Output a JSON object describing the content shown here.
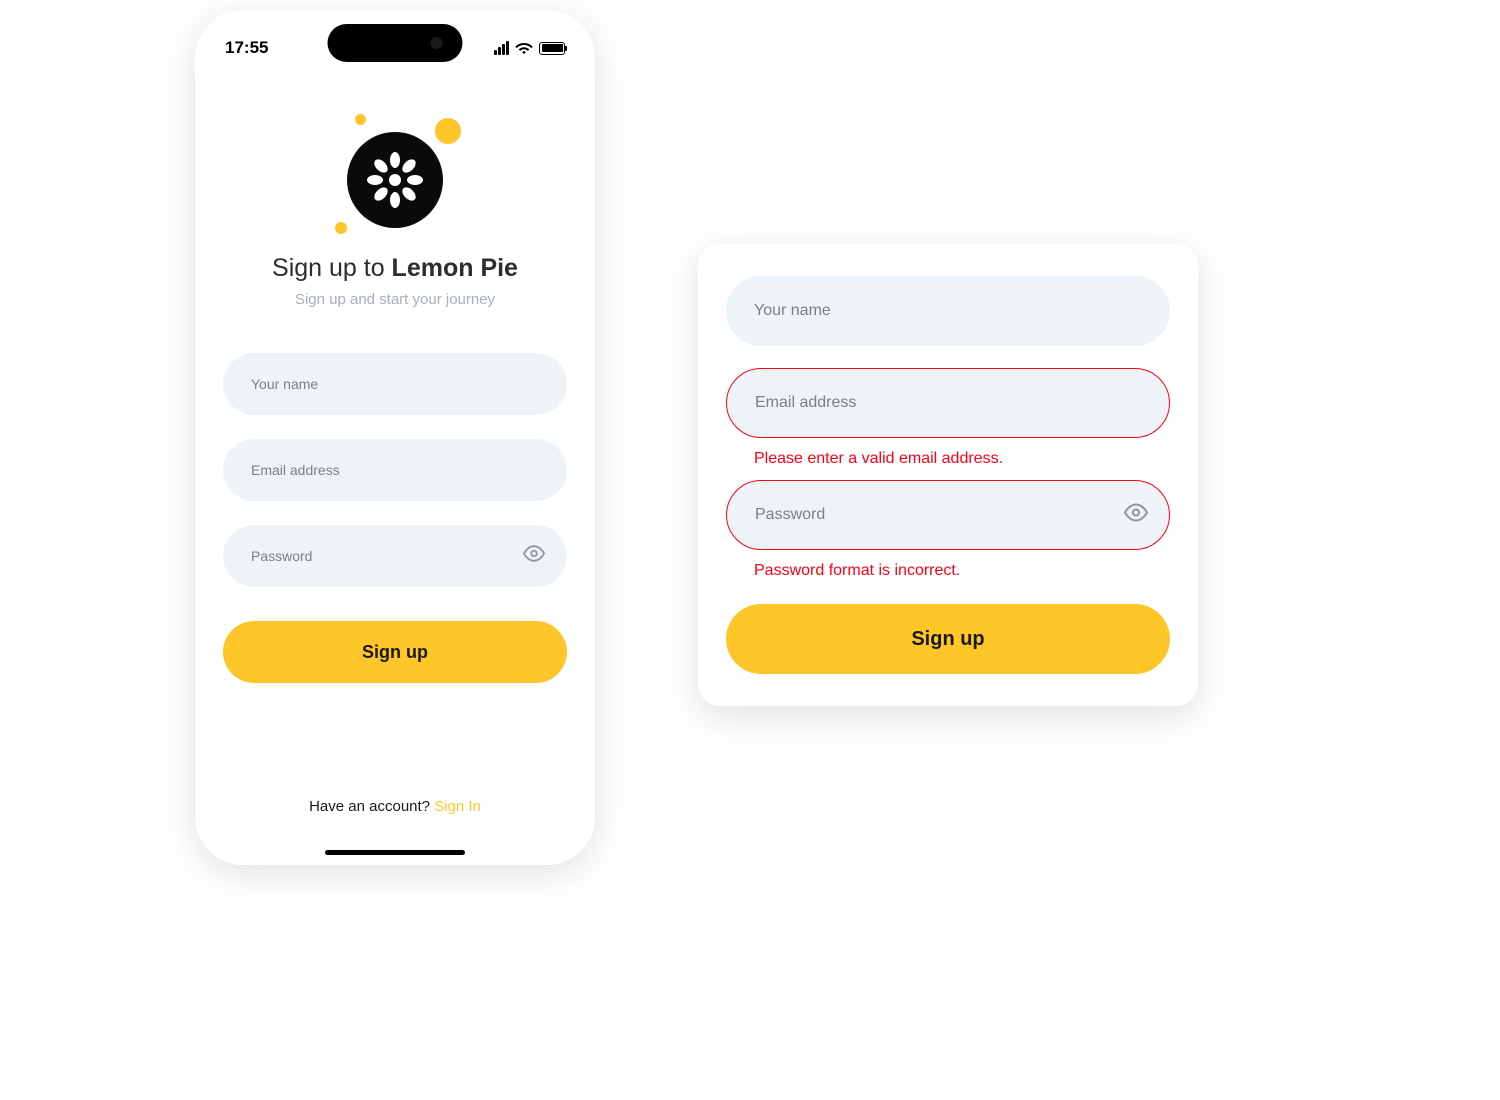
{
  "status": {
    "time": "17:55"
  },
  "branding": {
    "title_prefix": "Sign up to ",
    "title_bold": "Lemon Pie",
    "subtitle": "Sign up and start your journey"
  },
  "form": {
    "name_placeholder": "Your name",
    "email_placeholder": "Email address",
    "password_placeholder": "Password",
    "submit_label": "Sign up"
  },
  "footer": {
    "prompt": "Have an account? ",
    "link": "Sign In"
  },
  "error_card": {
    "name_placeholder": "Your name",
    "email_placeholder": "Email address",
    "email_error": "Please enter a valid email address.",
    "password_placeholder": "Password",
    "password_error": "Password format is incorrect.",
    "submit_label": "Sign up"
  },
  "colors": {
    "accent": "#ffc629",
    "input_bg": "#eef3f7",
    "error": "#ff0015"
  }
}
